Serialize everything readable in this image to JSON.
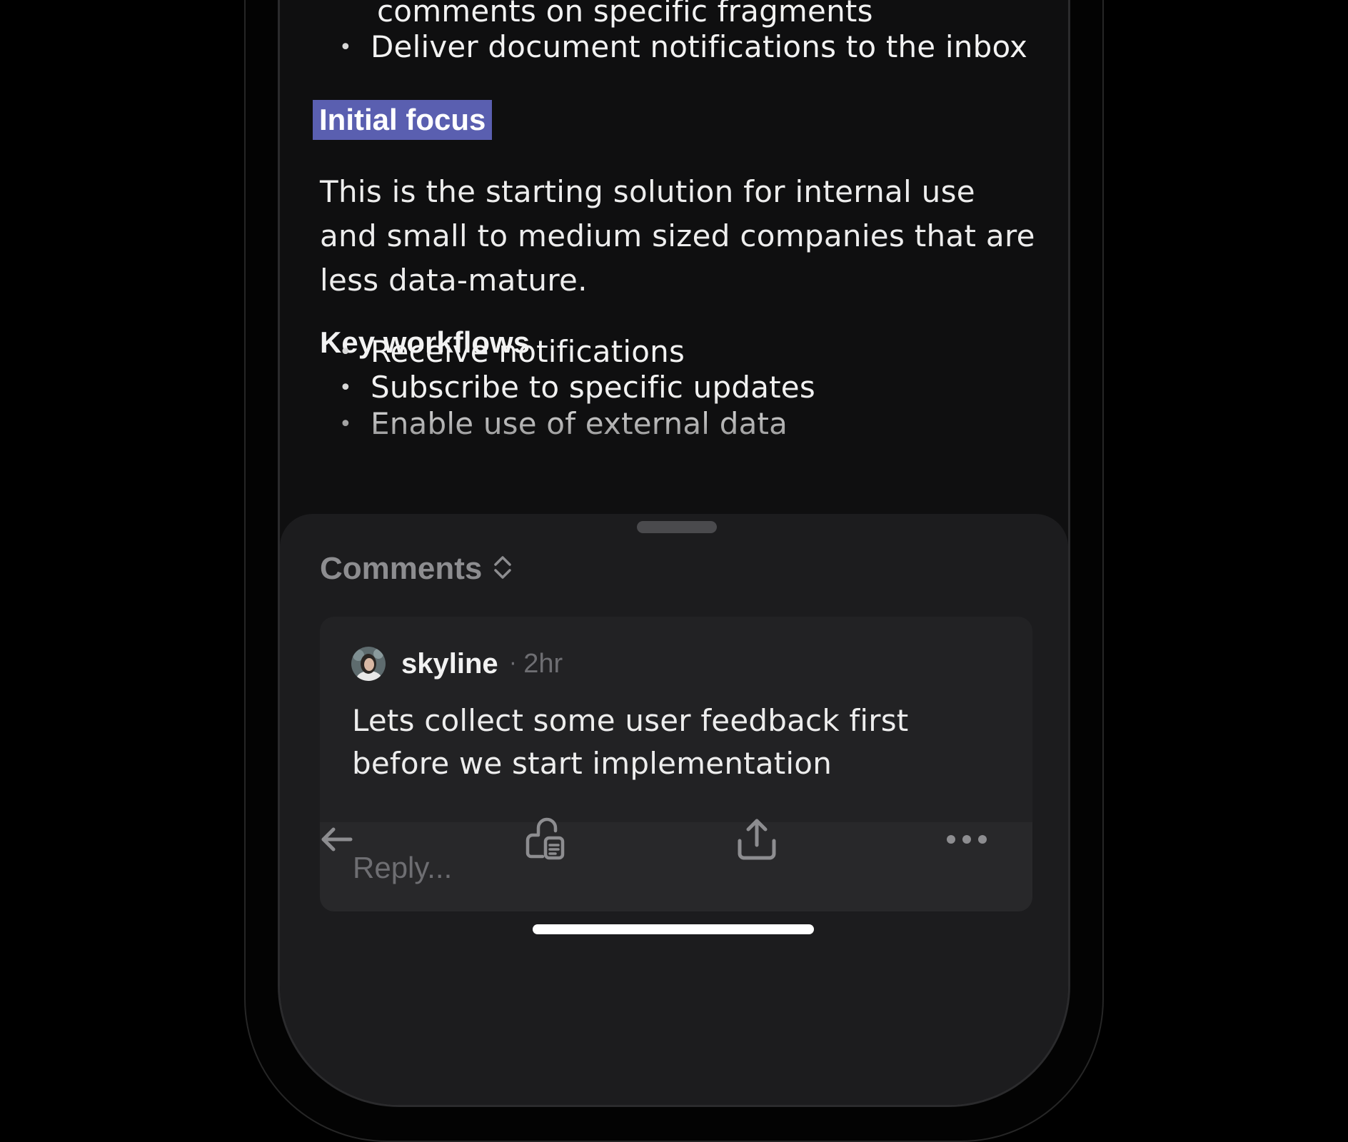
{
  "document": {
    "top_partial_line": "comments on specific fragments",
    "top_bullets": [
      "Deliver document notifications to the inbox"
    ],
    "section_heading": "Initial focus",
    "paragraph": "This is the starting solution for internal use and small to medium sized companies that are less data-mature.",
    "subheading": "Key workflows",
    "workflow_bullets": [
      "Receive notifications",
      "Subscribe to specific updates",
      "Enable use of external data"
    ],
    "bullet_glyph": "•"
  },
  "comments_sheet": {
    "title": "Comments",
    "title_icon": "chevron-up-down-icon",
    "comment": {
      "author": "skyline",
      "separator": "·",
      "time": "2hr",
      "body": "Lets collect some user feedback first before we start implementation",
      "avatar": "avatar"
    },
    "reply_placeholder": "Reply..."
  },
  "toolbar": {
    "icons": [
      "arrow-left-icon",
      "lock-document-icon",
      "share-icon",
      "more-icon"
    ]
  },
  "colors": {
    "highlight": "#5a5fb0",
    "background": "#0f0f10",
    "sheet": "#1c1c1e",
    "card": "#222224",
    "muted_text": "#6e6e72"
  }
}
